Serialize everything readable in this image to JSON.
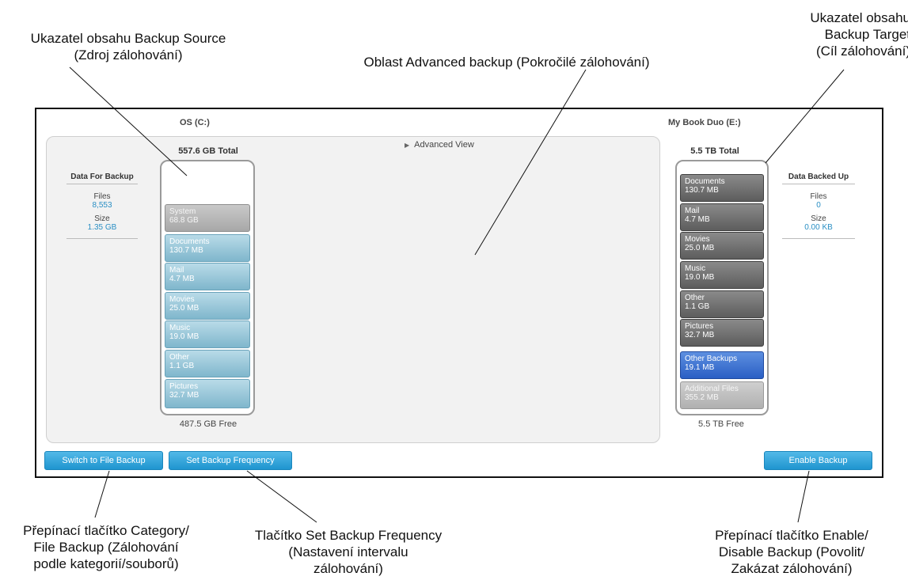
{
  "callouts": {
    "backup_source": [
      "Ukazatel obsahu Backup Source",
      "(Zdroj zálohování)"
    ],
    "advanced_area": "Oblast Advanced backup (Pokročilé zálohování)",
    "backup_target": [
      "Ukazatel obsahu",
      "Backup Target",
      "(Cíl zálohování)"
    ],
    "category_toggle": [
      "Přepínací tlačítko Category/",
      "File Backup (Zálohování",
      "podle kategorií/souborů)"
    ],
    "frequency_button": [
      "Tlačítko Set Backup Frequency",
      "(Nastavení intervalu",
      "zálohování)"
    ],
    "enable_toggle": [
      "Přepínací tlačítko Enable/",
      "Disable Backup (Povolit/",
      "Zakázat zálohování)"
    ]
  },
  "source": {
    "drive": "OS (C:)",
    "total": "557.6 GB Total",
    "free": "487.5 GB Free",
    "stats": {
      "header": "Data For Backup",
      "files_label": "Files",
      "files_value": "8,553",
      "size_label": "Size",
      "size_value": "1.35 GB"
    },
    "blocks": [
      {
        "name": "System",
        "size": "68.8 GB"
      },
      {
        "name": "Documents",
        "size": "130.7 MB"
      },
      {
        "name": "Mail",
        "size": "4.7 MB"
      },
      {
        "name": "Movies",
        "size": "25.0 MB"
      },
      {
        "name": "Music",
        "size": "19.0 MB"
      },
      {
        "name": "Other",
        "size": "1.1 GB"
      },
      {
        "name": "Pictures",
        "size": "32.7 MB"
      }
    ]
  },
  "advanced_view_label": "Advanced View",
  "target": {
    "drive": "My Book Duo (E:)",
    "total": "5.5 TB Total",
    "free": "5.5 TB Free",
    "stats": {
      "header": "Data Backed Up",
      "files_label": "Files",
      "files_value": "0",
      "size_label": "Size",
      "size_value": "0.00 KB"
    },
    "blocks": [
      {
        "name": "Documents",
        "size": "130.7 MB"
      },
      {
        "name": "Mail",
        "size": "4.7 MB"
      },
      {
        "name": "Movies",
        "size": "25.0 MB"
      },
      {
        "name": "Music",
        "size": "19.0 MB"
      },
      {
        "name": "Other",
        "size": "1.1 GB"
      },
      {
        "name": "Pictures",
        "size": "32.7 MB"
      },
      {
        "name": "Other Backups",
        "size": "19.1 MB"
      },
      {
        "name": "Additional Files",
        "size": "355.2 MB"
      }
    ]
  },
  "buttons": {
    "switch": "Switch to File Backup",
    "frequency": "Set Backup Frequency",
    "enable": "Enable Backup"
  },
  "colors": {
    "button": "#1f95cf",
    "stat_value": "#2a8fc4",
    "other_backups": "#2a5fc4"
  }
}
